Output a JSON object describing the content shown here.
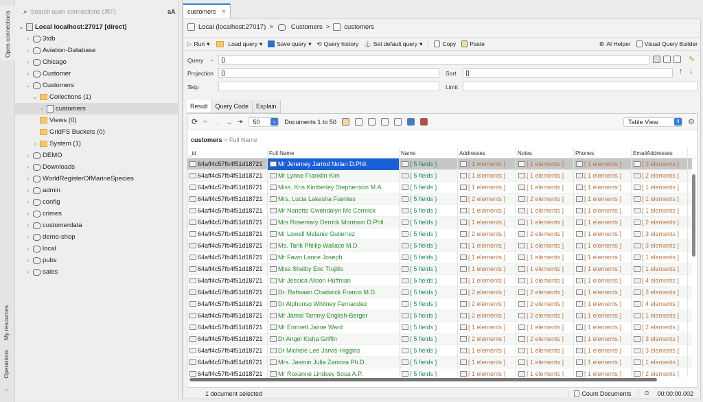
{
  "left_tabs": {
    "open_connections": "Open connections",
    "my_resources": "My resources",
    "operations": "Operations",
    "back": "←"
  },
  "sidebar": {
    "search_placeholder": "Search open connections (⌘F)",
    "case_toggle": "aA",
    "connection": "Local localhost:27017 [direct]",
    "items": [
      {
        "label": "3tdb",
        "type": "db",
        "level": 1,
        "chev": "›"
      },
      {
        "label": "Aviation-Database",
        "type": "db",
        "level": 1,
        "chev": "›"
      },
      {
        "label": "Chicago",
        "type": "db",
        "level": 1,
        "chev": "›"
      },
      {
        "label": "Customer",
        "type": "db",
        "level": 1,
        "chev": "›"
      },
      {
        "label": "Customers",
        "type": "db",
        "level": 1,
        "chev": "⌄"
      },
      {
        "label": "Collections (1)",
        "type": "folder",
        "level": 2,
        "chev": "⌄"
      },
      {
        "label": "customers",
        "type": "coll",
        "level": 3,
        "chev": "›",
        "selected": true
      },
      {
        "label": "Views (0)",
        "type": "folder",
        "level": 2,
        "chev": ""
      },
      {
        "label": "GridFS Buckets (0)",
        "type": "folder",
        "level": 2,
        "chev": ""
      },
      {
        "label": "System (1)",
        "type": "folder",
        "level": 2,
        "chev": "›"
      },
      {
        "label": "DEMO",
        "type": "db",
        "level": 1,
        "chev": "›"
      },
      {
        "label": "Downloads",
        "type": "db",
        "level": 1,
        "chev": "›"
      },
      {
        "label": "WorldRegisterOfMarineSpecies",
        "type": "db",
        "level": 1,
        "chev": "›"
      },
      {
        "label": "admin",
        "type": "db",
        "level": 1,
        "chev": "›"
      },
      {
        "label": "config",
        "type": "db",
        "level": 1,
        "chev": "›"
      },
      {
        "label": "crimes",
        "type": "db",
        "level": 1,
        "chev": "›"
      },
      {
        "label": "customerdata",
        "type": "db",
        "level": 1,
        "chev": "›"
      },
      {
        "label": "demo-shop",
        "type": "db",
        "level": 1,
        "chev": "›"
      },
      {
        "label": "local",
        "type": "db",
        "level": 1,
        "chev": "›"
      },
      {
        "label": "pubs",
        "type": "db",
        "level": 1,
        "chev": "›"
      },
      {
        "label": "sales",
        "type": "db",
        "level": 1,
        "chev": "›"
      }
    ]
  },
  "tab": {
    "label": "customers",
    "close": "×"
  },
  "breadcrumb": {
    "connection": "Local (localhost:27017)",
    "database": "Customers",
    "collection": "customers",
    "sep": ">"
  },
  "toolbar": {
    "run": "Run",
    "load_query": "Load query",
    "save_query": "Save query",
    "query_history": "Query history",
    "set_default": "Set default query",
    "copy": "Copy",
    "paste": "Paste",
    "ai_helper": "AI Helper",
    "visual_query_builder": "Visual Query Builder"
  },
  "query": {
    "query_label": "Query",
    "query_value": "{}",
    "projection_label": "Projection",
    "projection_value": "{}",
    "sort_label": "Sort",
    "sort_value": "{}",
    "skip_label": "Skip",
    "skip_value": "",
    "limit_label": "Limit",
    "limit_value": ""
  },
  "result_tabs": [
    "Result",
    "Query Code",
    "Explain"
  ],
  "nav": {
    "page_size": "50",
    "documents": "Documents 1 to 50",
    "view_mode": "Table View"
  },
  "path": {
    "root": "customers",
    "sep": ">",
    "field": "Full Name"
  },
  "columns": [
    "_id",
    "Full Name",
    "Name",
    "Addresses",
    "Notes",
    "Phones",
    "EmailAddresses"
  ],
  "rows": [
    [
      "64aff4c57fb4f51d18721",
      "Mr Jeremey Jarrod Nolan D.Phil.",
      "{ 5 fields }",
      "[ 1 elements ]",
      "[ 1 elements ]",
      "[ 1 elements ]",
      "[ 3 elements ]"
    ],
    [
      "64aff4c57fb4f51d18721",
      "Mr Lynne Franklin Kim",
      "{ 5 fields }",
      "[ 1 elements ]",
      "[ 1 elements ]",
      "[ 1 elements ]",
      "[ 2 elements ]"
    ],
    [
      "64aff4c57fb4f51d18721",
      "Miss. Kris Kimberley Stephenson M.A.",
      "{ 5 fields }",
      "[ 1 elements ]",
      "[ 1 elements ]",
      "[ 1 elements ]",
      "[ 1 elements ]"
    ],
    [
      "64aff4c57fb4f51d18721",
      "Mrs. Lucia Lakesha Fuentes",
      "{ 5 fields }",
      "[ 2 elements ]",
      "[ 2 elements ]",
      "[ 1 elements ]",
      "[ 1 elements ]"
    ],
    [
      "64aff4c57fb4f51d18721",
      "Mr Nanette Gwendolyn Mc Cormick",
      "{ 5 fields }",
      "[ 1 elements ]",
      "[ 1 elements ]",
      "[ 1 elements ]",
      "[ 1 elements ]"
    ],
    [
      "64aff4c57fb4f51d18721",
      "Mrs Rosemary Derrick Morrison D.Phil.",
      "{ 5 fields }",
      "[ 1 elements ]",
      "[ 1 elements ]",
      "[ 1 elements ]",
      "[ 2 elements ]"
    ],
    [
      "64aff4c57fb4f51d18721",
      "Mr Lowell Melanie Gutierrez",
      "{ 5 fields }",
      "[ 2 elements ]",
      "[ 2 elements ]",
      "[ 1 elements ]",
      "[ 3 elements ]"
    ],
    [
      "64aff4c57fb4f51d18721",
      "Ms. Tarik Phillip Wallace M.D.",
      "{ 5 fields }",
      "[ 1 elements ]",
      "[ 1 elements ]",
      "[ 1 elements ]",
      "[ 3 elements ]"
    ],
    [
      "64aff4c57fb4f51d18721",
      "Mr Fawn Lance Joseph",
      "{ 5 fields }",
      "[ 1 elements ]",
      "[ 1 elements ]",
      "[ 1 elements ]",
      "[ 1 elements ]"
    ],
    [
      "64aff4c57fb4f51d18721",
      "Miss Shelby Eric Trujillo",
      "{ 5 fields }",
      "[ 1 elements ]",
      "[ 1 elements ]",
      "[ 1 elements ]",
      "[ 1 elements ]"
    ],
    [
      "64aff4c57fb4f51d18721",
      "Mr Jessica Alison Huffman",
      "{ 5 fields }",
      "[ 1 elements ]",
      "[ 1 elements ]",
      "[ 1 elements ]",
      "[ 4 elements ]"
    ],
    [
      "64aff4c57fb4f51d18721",
      "Dr. Rahsaan Chadwick Franco M.D.",
      "{ 5 fields }",
      "[ 2 elements ]",
      "[ 2 elements ]",
      "[ 1 elements ]",
      "[ 3 elements ]"
    ],
    [
      "64aff4c57fb4f51d18721",
      "Dr Alphonso Whitney Fernandez",
      "{ 5 fields }",
      "[ 2 elements ]",
      "[ 2 elements ]",
      "[ 1 elements ]",
      "[ 4 elements ]"
    ],
    [
      "64aff4c57fb4f51d18721",
      "Mr Jamal Tammy English-Berger",
      "{ 5 fields }",
      "[ 2 elements ]",
      "[ 2 elements ]",
      "[ 1 elements ]",
      "[ 1 elements ]"
    ],
    [
      "64aff4c57fb4f51d18721",
      "Mr Emmett Jaime Ward",
      "{ 5 fields }",
      "[ 1 elements ]",
      "[ 1 elements ]",
      "[ 1 elements ]",
      "[ 2 elements ]"
    ],
    [
      "64aff4c57fb4f51d18721",
      "Dr Angel Kisha Griffin",
      "{ 5 fields }",
      "[ 2 elements ]",
      "[ 2 elements ]",
      "[ 1 elements ]",
      "[ 3 elements ]"
    ],
    [
      "64aff4c57fb4f51d18721",
      "Dr Michele Lee Jarvis-Higgins",
      "{ 5 fields }",
      "[ 1 elements ]",
      "[ 1 elements ]",
      "[ 1 elements ]",
      "[ 3 elements ]"
    ],
    [
      "64aff4c57fb4f51d18721",
      "Mrs. Jasmin Julia Zamora Ph.D.",
      "{ 5 fields }",
      "[ 1 elements ]",
      "[ 1 elements ]",
      "[ 1 elements ]",
      "[ 1 elements ]"
    ],
    [
      "64aff4c57fb4f51d18721",
      "Mr Roxanne Lindsey Sosa A.P.",
      "{ 5 fields }",
      "[ 1 elements ]",
      "[ 1 elements ]",
      "[ 1 elements ]",
      "[ 2 elements ]"
    ]
  ],
  "selected_row": 0,
  "status": {
    "selection": "1 document selected",
    "count_documents": "Count Documents",
    "elapsed": "00:00:00.002"
  },
  "colors": {
    "accent": "#1a5fd6",
    "name_text": "#2f8a2f",
    "object_text": "#26886a",
    "array_text": "#b8774a"
  }
}
